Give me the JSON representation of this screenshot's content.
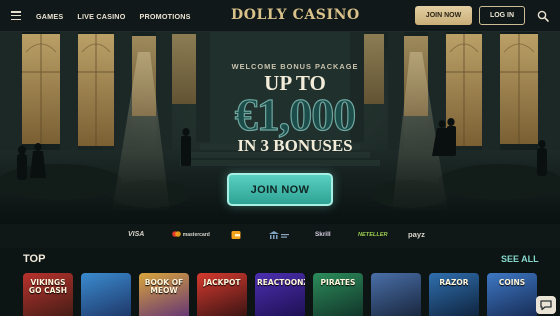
{
  "nav": {
    "menu_icon": "hamburger-icon",
    "links": [
      "GAMES",
      "LIVE CASINO",
      "PROMOTIONS"
    ]
  },
  "brand": {
    "logo_text": "DOLLY CASINO",
    "color": "#d9c28a"
  },
  "header_actions": {
    "join": "JOIN NOW",
    "login": "LOG IN",
    "search_icon": "search-icon"
  },
  "hero": {
    "subtitle": "WELCOME BONUS PACKAGE",
    "up_to": "UP TO",
    "amount": "€1,000",
    "bonuses": "IN 3 BONUSES",
    "cta": "JOIN NOW",
    "cta_color": "#3fb9aa"
  },
  "payments": [
    "VISA",
    "mastercard",
    "",
    "",
    "Skrill",
    "NETELLER",
    "payz"
  ],
  "games": {
    "title": "TOP",
    "see_all": "SEE ALL",
    "tiles": [
      {
        "label": "VIKINGS GO CASH",
        "c1": "#b8322d",
        "c2": "#3a1b14"
      },
      {
        "label": "",
        "c1": "#3b8bd0",
        "c2": "#1b2f5e"
      },
      {
        "label": "BOOK OF MEOW",
        "c1": "#d9a53c",
        "c2": "#5a2a7a"
      },
      {
        "label": "JACKPOT",
        "c1": "#d63a2f",
        "c2": "#2b1010"
      },
      {
        "label": "REACTOONZ",
        "c1": "#4c2fb0",
        "c2": "#1a0d4a"
      },
      {
        "label": "PIRATES",
        "c1": "#2c8c5a",
        "c2": "#0f2c25"
      },
      {
        "label": "",
        "c1": "#4a6fa8",
        "c2": "#141f33"
      },
      {
        "label": "RAZOR",
        "c1": "#2f6fae",
        "c2": "#0c1c33"
      },
      {
        "label": "COINS",
        "c1": "#3e78c4",
        "c2": "#13244a"
      }
    ]
  },
  "chat_icon": "chat-icon"
}
